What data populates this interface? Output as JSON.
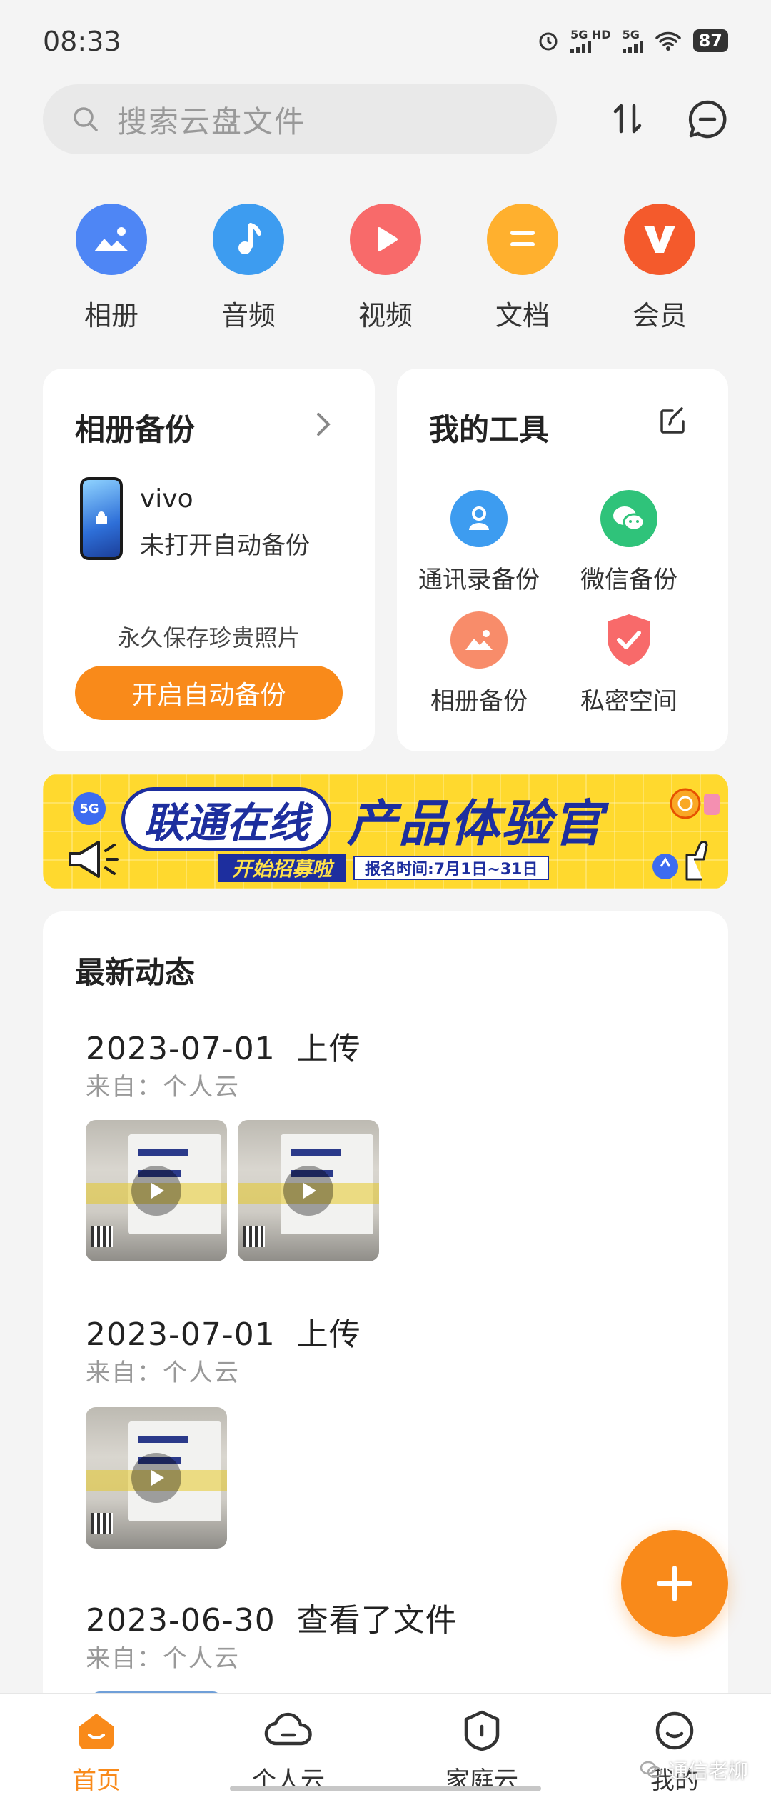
{
  "status_bar": {
    "time": "08:33",
    "signal_1": "5G HD",
    "signal_2": "5G",
    "battery": "87"
  },
  "search": {
    "placeholder": "搜索云盘文件"
  },
  "quick_actions": [
    {
      "label": "相册",
      "icon": "photo-album-icon",
      "color": "#4e86f5"
    },
    {
      "label": "音频",
      "icon": "music-note-icon",
      "color": "#3d9cf0"
    },
    {
      "label": "视频",
      "icon": "video-play-icon",
      "color": "#f86a6a"
    },
    {
      "label": "文档",
      "icon": "document-icon",
      "color": "#ffb02e"
    },
    {
      "label": "会员",
      "icon": "vip-v-icon",
      "color": "#f45a2c"
    }
  ],
  "album_backup": {
    "title": "相册备份",
    "device_name": "vivo",
    "device_status": "未打开自动备份",
    "slogan": "永久保存珍贵照片",
    "button": "开启自动备份"
  },
  "my_tools": {
    "title": "我的工具",
    "items": [
      {
        "label": "通讯录备份",
        "icon": "contacts-backup-icon",
        "color": "#3d9cf0"
      },
      {
        "label": "微信备份",
        "icon": "wechat-backup-icon",
        "color": "#2fc37a"
      },
      {
        "label": "相册备份",
        "icon": "photo-backup-icon",
        "color": "#f88c6a"
      },
      {
        "label": "私密空间",
        "icon": "private-space-shield-icon",
        "color": "#f86a6a"
      }
    ]
  },
  "banner": {
    "main_a": "联通在线",
    "main_b": "产品体验官",
    "sub_a": "开始招募啦",
    "sub_b": "报名时间:7月1日~31日",
    "badge": "5G"
  },
  "activity": {
    "title": "最新动态",
    "entries": [
      {
        "date": "2023-07-01",
        "action": "上传",
        "source": "来自：个人云",
        "thumbs": 2
      },
      {
        "date": "2023-07-01",
        "action": "上传",
        "source": "来自：个人云",
        "thumbs": 1
      },
      {
        "date": "2023-06-30",
        "action": "查看了文件",
        "source": "来自：个人云",
        "thumbs": 0
      }
    ]
  },
  "thumb_text": {
    "line1": "上海天",
    "line2": "参观指",
    "band": "参观全新的上海"
  },
  "bottom_nav": [
    {
      "label": "首页",
      "icon": "home-icon",
      "active": true
    },
    {
      "label": "个人云",
      "icon": "cloud-icon",
      "active": false
    },
    {
      "label": "家庭云",
      "icon": "family-home-icon",
      "active": false
    },
    {
      "label": "我的",
      "icon": "profile-smile-icon",
      "active": false
    }
  ],
  "watermark": "通信老柳",
  "colors": {
    "accent": "#f98a1a",
    "banner_bg": "#ffd92e",
    "banner_blue": "#1d2e9e"
  }
}
